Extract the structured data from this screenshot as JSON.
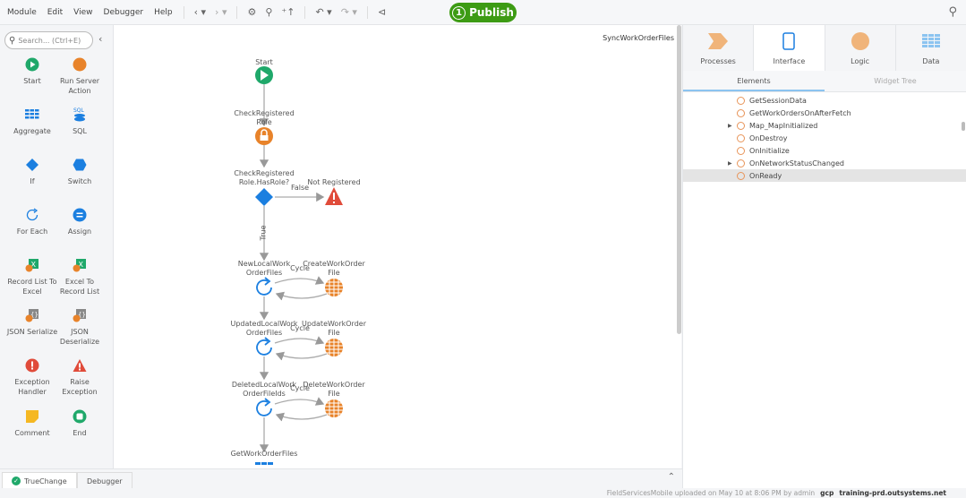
{
  "menu": {
    "items": [
      "Module",
      "Edit",
      "View",
      "Debugger",
      "Help"
    ],
    "publish_count": "1",
    "publish_label": "Publish"
  },
  "toolbox": {
    "search_placeholder": "Search... (Ctrl+E)",
    "tools": [
      {
        "label": "Start"
      },
      {
        "label": "Run Server Action"
      },
      {
        "label": "Aggregate"
      },
      {
        "label": "SQL"
      },
      {
        "label": "If"
      },
      {
        "label": "Switch"
      },
      {
        "label": "For Each"
      },
      {
        "label": "Assign"
      },
      {
        "label": "Record List To Excel"
      },
      {
        "label": "Excel To Record List"
      },
      {
        "label": "JSON Serialize"
      },
      {
        "label": "JSON Deserialize"
      },
      {
        "label": "Exception Handler"
      },
      {
        "label": "Raise Exception"
      },
      {
        "label": "Comment"
      },
      {
        "label": "End"
      }
    ]
  },
  "canvas": {
    "title": "SyncWorkOrderFiles",
    "nodes": {
      "start": "Start",
      "check_role": "CheckRegistered Role",
      "if": "CheckRegistered Role.HasRole?",
      "not_registered": "Not Registered",
      "false": "False",
      "true": "True",
      "loop1": "NewLocalWork OrderFiles",
      "agg1": "CreateWorkOrder File",
      "loop2": "UpdatedLocalWork OrderFiles",
      "agg2": "UpdateWorkOrder File",
      "loop3": "DeletedLocalWork OrderFileIds",
      "agg3": "DeleteWorkOrder File",
      "cycle": "Cycle",
      "get": "GetWorkOrderFiles"
    }
  },
  "rpanel": {
    "tabs": [
      "Processes",
      "Interface",
      "Logic",
      "Data"
    ],
    "active_tab": "Interface",
    "subtabs": [
      "Elements",
      "Widget Tree"
    ],
    "items": [
      {
        "label": "GetSessionData",
        "expandable": false
      },
      {
        "label": "GetWorkOrdersOnAfterFetch",
        "expandable": false
      },
      {
        "label": "Map_MapInitialized",
        "expandable": true
      },
      {
        "label": "OnDestroy",
        "expandable": false
      },
      {
        "label": "OnInitialize",
        "expandable": false
      },
      {
        "label": "OnNetworkStatusChanged",
        "expandable": true
      },
      {
        "label": "OnReady",
        "expandable": false,
        "selected": true
      }
    ]
  },
  "bottom": {
    "tabs": [
      "TrueChange",
      "Debugger"
    ]
  },
  "status": {
    "message": "FieldServicesMobile uploaded on May 10 at 8:06 PM by admin",
    "env": "gcp",
    "server": "training-prd.outsystems.net"
  },
  "colors": {
    "publish": "#3d9b14",
    "start": "#1fa86a",
    "logic": "#e8832a",
    "accent": "#1b7fe0",
    "error": "#e04b3a"
  }
}
